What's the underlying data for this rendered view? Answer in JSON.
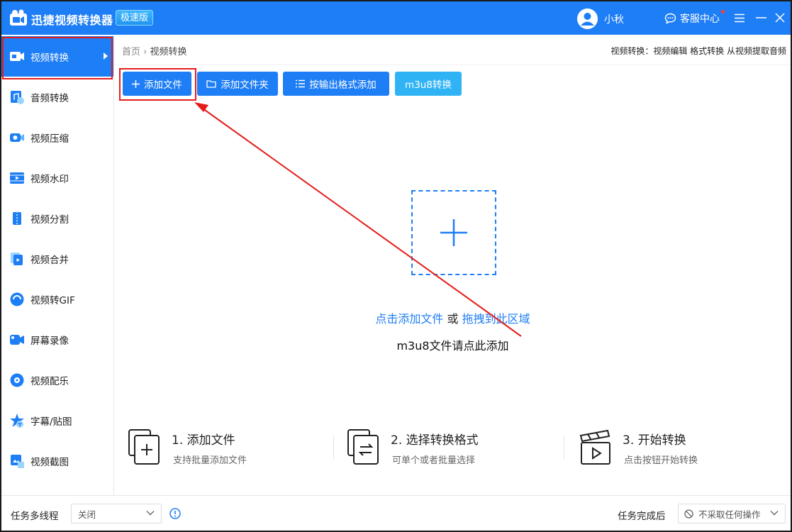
{
  "titlebar": {
    "app_title": "迅捷视频转换器",
    "edition_badge": "极速版",
    "username": "小秋",
    "service_label": "客服中心"
  },
  "sidebar": {
    "items": [
      {
        "label": "视频转换",
        "icon": "video-convert-icon",
        "active": true
      },
      {
        "label": "音频转换",
        "icon": "audio-convert-icon"
      },
      {
        "label": "视频压缩",
        "icon": "video-compress-icon"
      },
      {
        "label": "视频水印",
        "icon": "video-watermark-icon"
      },
      {
        "label": "视频分割",
        "icon": "video-split-icon"
      },
      {
        "label": "视频合并",
        "icon": "video-merge-icon"
      },
      {
        "label": "视频转GIF",
        "icon": "video-to-gif-icon"
      },
      {
        "label": "屏幕录像",
        "icon": "screen-record-icon"
      },
      {
        "label": "视频配乐",
        "icon": "video-music-icon"
      },
      {
        "label": "字幕/贴图",
        "icon": "subtitle-sticker-icon"
      },
      {
        "label": "视频截图",
        "icon": "video-screenshot-icon"
      }
    ]
  },
  "breadcrumb": {
    "home": "首页",
    "separator": "›",
    "current": "视频转换"
  },
  "top_links": "视频转换：视频编辑 格式转换 从视频提取音频",
  "toolbar": {
    "add_file": "添加文件",
    "add_folder": "添加文件夹",
    "add_by_format": "按输出格式添加",
    "m3u8": "m3u8转换"
  },
  "drop": {
    "click_add": "点击添加文件",
    "or": " 或 ",
    "drag_here": "拖拽到此区域",
    "m3u8_hint": "m3u8文件请点此添加"
  },
  "steps": [
    {
      "title": "1. 添加文件",
      "desc": "支持批量添加文件"
    },
    {
      "title": "2. 选择转换格式",
      "desc": "可单个或者批量选择"
    },
    {
      "title": "3. 开始转换",
      "desc": "点击按钮开始转换"
    }
  ],
  "footer": {
    "multithread_label": "任务多线程",
    "multithread_value": "关闭",
    "after_done_label": "任务完成后",
    "after_done_value": "不采取任何操作"
  },
  "colors": {
    "brand": "#1e7ef5",
    "light_button": "#30b3f5",
    "annotation_red": "#e51c1c"
  }
}
